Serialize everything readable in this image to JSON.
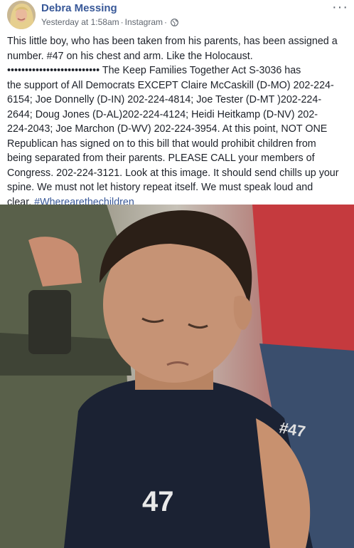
{
  "post": {
    "author": "Debra Messing",
    "timestamp": "Yesterday at 1:58am",
    "separator": "·",
    "source": "Instagram",
    "more_label": "···",
    "text_lines": [
      "This little boy, who has been taken from his parents, has been assigned a",
      "number. #47 on his chest and arm. Like the Holocaust.",
      "•••••••••••••••••••••••••• The Keep Families Together Act S-3036 has",
      "the support of All Democrats EXCEPT Claire McCaskill (D-MO) 202-224-",
      "6154; Joe Donnelly (D-IN) 202-224-4814; Joe Tester (D-MT )202-224-",
      "2644; Doug Jones (D-AL)202-224-4124; Heidi Heitkamp (D-NV) 202-",
      "224-2043; Joe Marchon (D-WV) 202-224-3954. At this point, NOT ONE",
      "Republican has signed on to this bill that would prohibit children from",
      "being separated from their parents. PLEASE CALL your members of",
      "Congress. 202-224-3121. Look at this image. It should send chills up your",
      "spine. We must not let history repeat itself. We must speak loud and",
      "clear. "
    ],
    "hashtag": "#Wherearethechildren",
    "shirt_number": "47",
    "shirt_sleeve": "#47"
  },
  "colors": {
    "link": "#385898",
    "meta": "#616770",
    "text": "#1d2129"
  }
}
